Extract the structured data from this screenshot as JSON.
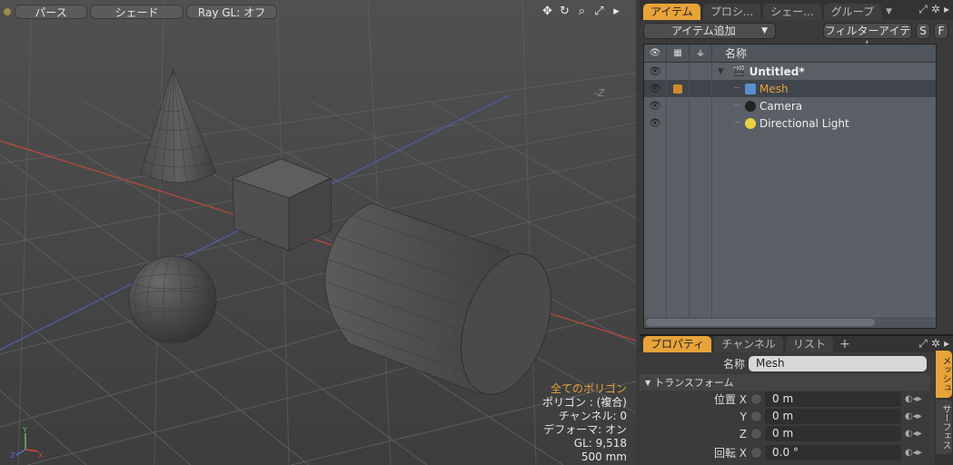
{
  "viewport": {
    "toolbar": {
      "perspective": "パース",
      "shade": "シェード",
      "raygl": "Ray GL: オフ"
    },
    "axis_label": "-Z",
    "stats": {
      "title": "全てのポリゴン",
      "polygons": "ポリゴン : (複合)",
      "channels": "チャンネル: 0",
      "deformers": "デフォーマ: オン",
      "gl": "GL: 9,518",
      "scale": "500 mm"
    },
    "gizmo": {
      "x": "X",
      "y": "Y",
      "z": "Z"
    }
  },
  "items_panel": {
    "tabs": [
      "アイテム",
      "プロシ...",
      "シェー...",
      "グループ"
    ],
    "add_item": "アイテム追加",
    "filter": "フィルターアイテム",
    "s_btn": "S",
    "f_btn": "F",
    "name_header": "名称",
    "tree": [
      {
        "label": "Untitled*",
        "bold": true,
        "selected": false
      },
      {
        "label": "Mesh",
        "bold": false,
        "selected": true
      },
      {
        "label": "Camera",
        "bold": false,
        "selected": false
      },
      {
        "label": "Directional Light",
        "bold": false,
        "selected": false
      }
    ]
  },
  "props_panel": {
    "tabs": [
      "プロパティ",
      "チャンネル",
      "リスト"
    ],
    "name_label": "名称",
    "name_value": "Mesh",
    "section_transform": "トランスフォーム",
    "position_label": "位置 X",
    "y_label": "Y",
    "z_label": "Z",
    "pos_x": "0 m",
    "pos_y": "0 m",
    "pos_z": "0 m",
    "rotation_label": "回転 X",
    "rot_x": "0.0 °",
    "side_tabs": [
      "メッシュ",
      "サーフェス"
    ]
  },
  "colors": {
    "accent": "#e8a33a",
    "x_axis": "#c0483a",
    "z_axis": "#4a5fc0"
  }
}
